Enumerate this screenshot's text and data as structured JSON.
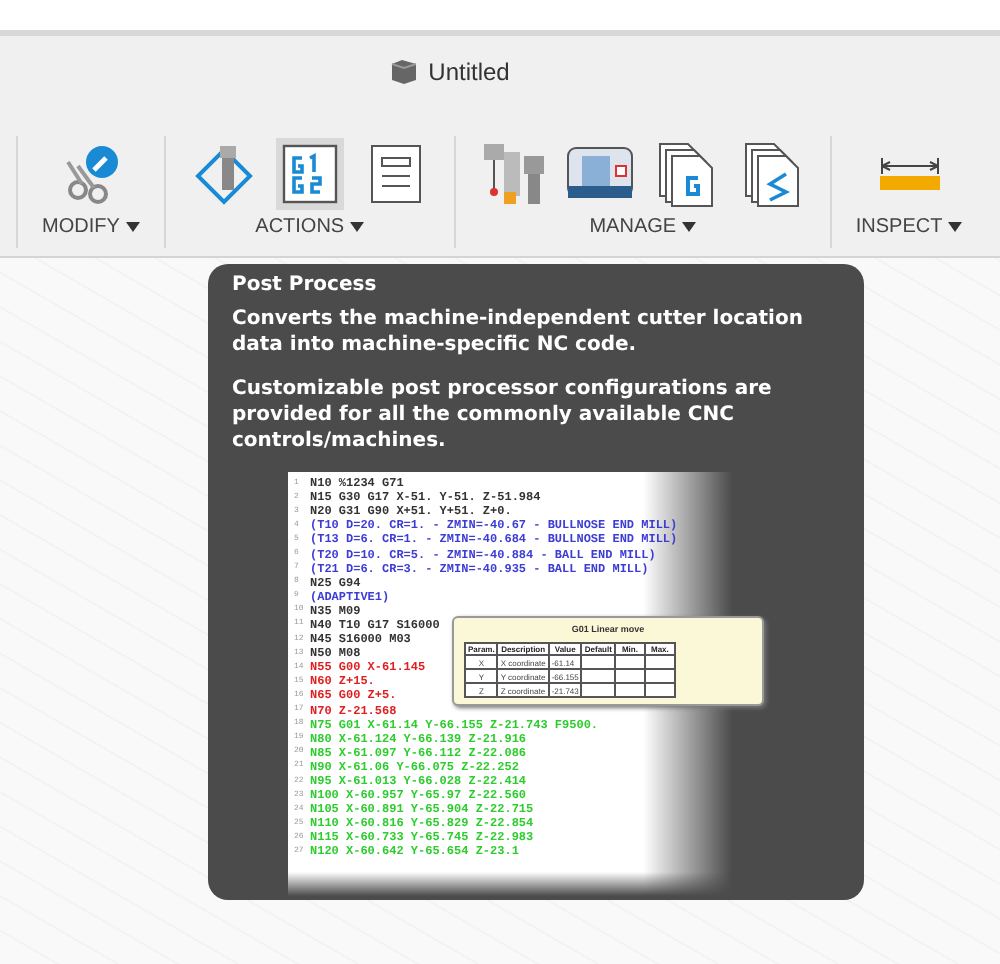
{
  "document_tab": {
    "title": "Untitled"
  },
  "toolbar": [
    {
      "label": "MODIFY",
      "buttons": [
        {
          "kind": "modify",
          "selected": false
        }
      ]
    },
    {
      "label": "ACTIONS",
      "buttons": [
        {
          "kind": "simulate",
          "selected": false
        },
        {
          "kind": "post",
          "selected": true
        },
        {
          "kind": "sheet",
          "selected": false
        }
      ]
    },
    {
      "label": "MANAGE",
      "buttons": [
        {
          "kind": "tools",
          "selected": false
        },
        {
          "kind": "machine",
          "selected": false
        },
        {
          "kind": "posts",
          "selected": false
        },
        {
          "kind": "templates",
          "selected": false
        }
      ]
    },
    {
      "label": "INSPECT",
      "buttons": [
        {
          "kind": "measure",
          "selected": false
        }
      ]
    }
  ],
  "tooltip": {
    "title": "Post Process",
    "paragraphs": [
      "Converts the machine-independent cutter location data into machine-specific NC code.",
      "Customizable post processor configurations are provided for all the commonly available CNC controls/machines."
    ],
    "preview": {
      "lines": [
        {
          "number": "1",
          "text": "N10 %1234 G71",
          "color": "#333333"
        },
        {
          "number": "2",
          "text": "N15 G30 G17 X-51. Y-51. Z-51.984",
          "color": "#333333"
        },
        {
          "number": "3",
          "text": "N20 G31 G90 X+51. Y+51. Z+0.",
          "color": "#333333"
        },
        {
          "number": "4",
          "text": "(T10 D=20. CR=1. - ZMIN=-40.67 - BULLNOSE END MILL)",
          "color": "#3d3dd6"
        },
        {
          "number": "5",
          "text": "(T13 D=6. CR=1. - ZMIN=-40.684 - BULLNOSE END MILL)",
          "color": "#3d3dd6"
        },
        {
          "number": "6",
          "text": "(T20 D=10. CR=5. - ZMIN=-40.884 - BALL END MILL)",
          "color": "#3d3dd6"
        },
        {
          "number": "7",
          "text": "(T21 D=6. CR=3. - ZMIN=-40.935 - BALL END MILL)",
          "color": "#3d3dd6"
        },
        {
          "number": "8",
          "text": "N25 G94",
          "color": "#333333"
        },
        {
          "number": "9",
          "text": "(ADAPTIVE1)",
          "color": "#3d3dd6"
        },
        {
          "number": "10",
          "text": "N35 M09",
          "color": "#333333"
        },
        {
          "number": "11",
          "text": "N40 T10 G17 S16000",
          "color": "#333333"
        },
        {
          "number": "12",
          "text": "N45 S16000 M03",
          "color": "#333333"
        },
        {
          "number": "13",
          "text": "N50 M08",
          "color": "#333333"
        },
        {
          "number": "14",
          "text": "N55 G00 X-61.145",
          "color": "#e02020"
        },
        {
          "number": "15",
          "text": "N60 Z+15.",
          "color": "#e02020"
        },
        {
          "number": "16",
          "text": "N65 G00 Z+5.",
          "color": "#e02020"
        },
        {
          "number": "17",
          "text": "N70 Z-21.568",
          "color": "#e02020"
        },
        {
          "number": "18",
          "text": "N75 G01 X-61.14 Y-66.155 Z-21.743 F9500.",
          "color": "#2ecc2e"
        },
        {
          "number": "19",
          "text": "N80 X-61.124 Y-66.139 Z-21.916",
          "color": "#2ecc2e"
        },
        {
          "number": "20",
          "text": "N85 X-61.097 Y-66.112 Z-22.086",
          "color": "#2ecc2e"
        },
        {
          "number": "21",
          "text": "N90 X-61.06 Y-66.075 Z-22.252",
          "color": "#2ecc2e"
        },
        {
          "number": "22",
          "text": "N95 X-61.013 Y-66.028 Z-22.414",
          "color": "#2ecc2e"
        },
        {
          "number": "23",
          "text": "N100 X-60.957 Y-65.97 Z-22.560",
          "color": "#2ecc2e"
        },
        {
          "number": "24",
          "text": "N105 X-60.891 Y-65.904 Z-22.715",
          "color": "#2ecc2e"
        },
        {
          "number": "25",
          "text": "N110 X-60.816 Y-65.829 Z-22.854",
          "color": "#2ecc2e"
        },
        {
          "number": "26",
          "text": "N115 X-60.733 Y-65.745 Z-22.983",
          "color": "#2ecc2e"
        },
        {
          "number": "27",
          "text": "N120 X-60.642 Y-65.654 Z-23.1",
          "color": "#2ecc2e"
        }
      ],
      "popup": {
        "title": "G01 Linear move",
        "columns": [
          "Param.",
          "Description",
          "Value",
          "Default",
          "Min.",
          "Max."
        ],
        "rows": [
          [
            "X",
            "X coordinate",
            "-61.14",
            "",
            "",
            ""
          ],
          [
            "Y",
            "Y coordinate",
            "-66.155",
            "",
            "",
            ""
          ],
          [
            "Z",
            "Z coordinate",
            "-21.743",
            "",
            "",
            ""
          ]
        ]
      }
    }
  }
}
